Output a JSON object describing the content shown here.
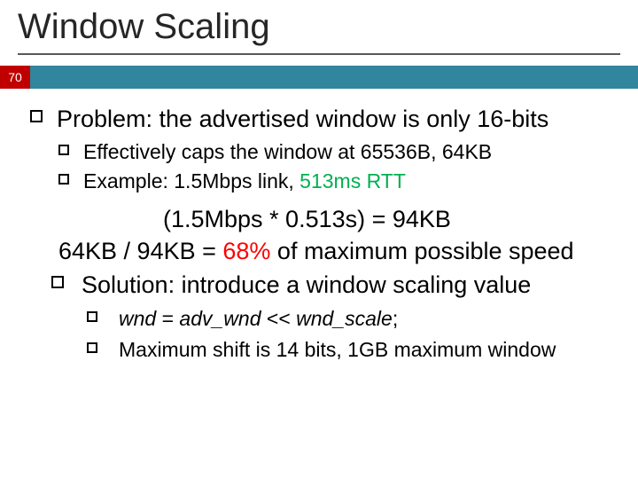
{
  "slide": {
    "title": "Window Scaling",
    "page_number": "70",
    "bullets": {
      "problem": "Problem: the advertised window is only 16-bits",
      "sub1": "Effectively caps the window at 65536B, 64KB",
      "sub2_a": "Example: 1.5Mbps link, ",
      "sub2_rtt": "513ms RTT",
      "calc_line1": "(1.5Mbps * 0.513s) = 94KB",
      "calc_line2a": "64KB / 94KB = ",
      "calc_pct": "68%",
      "calc_line2b": " of maximum possible speed",
      "solution": "Solution: introduce a window scaling value",
      "code_a": "wnd",
      "code_b": " = ",
      "code_c": "adv_wnd",
      "code_d": " << ",
      "code_e": "wnd_scale",
      "code_f": ";",
      "max_shift": "Maximum shift is 14 bits, 1GB maximum window"
    }
  }
}
